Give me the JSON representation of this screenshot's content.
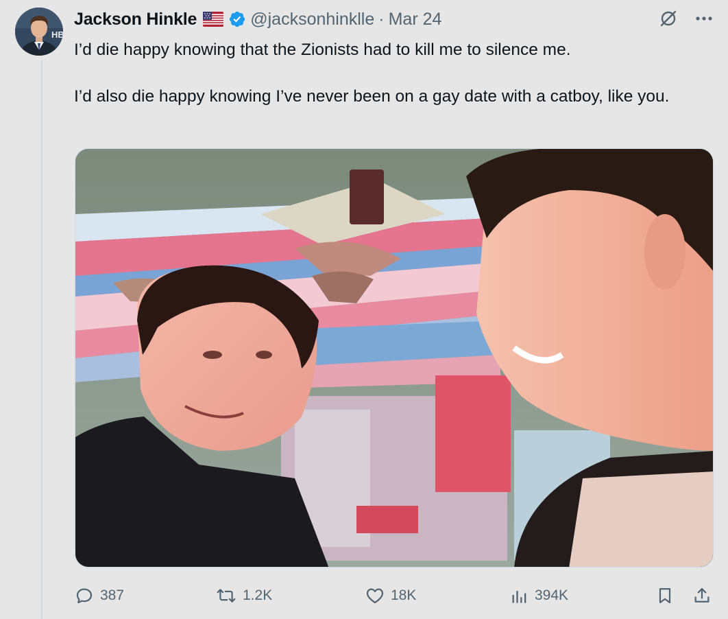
{
  "tweet": {
    "author_name": "Jackson Hinkle",
    "handle": "@jacksonhinklle",
    "separator": "·",
    "date": "Mar 24",
    "avatar_letters": "HB",
    "paragraphs": [
      "I’d die happy knowing that the Zionists had to kill me to silence me.",
      "I’d also die happy knowing I’ve never been on a gay date with a catboy, like you."
    ]
  },
  "stats": {
    "replies": "387",
    "reposts": "1.2K",
    "likes": "18K",
    "views": "394K"
  },
  "colors": {
    "text_primary": "#0f1419",
    "text_secondary": "#536471",
    "verified_blue": "#1d9bf0",
    "background": "#e6e6e6"
  },
  "icons": {
    "flag": "us-flag-icon",
    "verified": "verified-badge-icon",
    "grok": "grok-icon",
    "more": "more-icon",
    "reply": "reply-icon",
    "repost": "repost-icon",
    "like": "like-icon",
    "views": "views-icon",
    "bookmark": "bookmark-icon",
    "share": "share-icon"
  }
}
